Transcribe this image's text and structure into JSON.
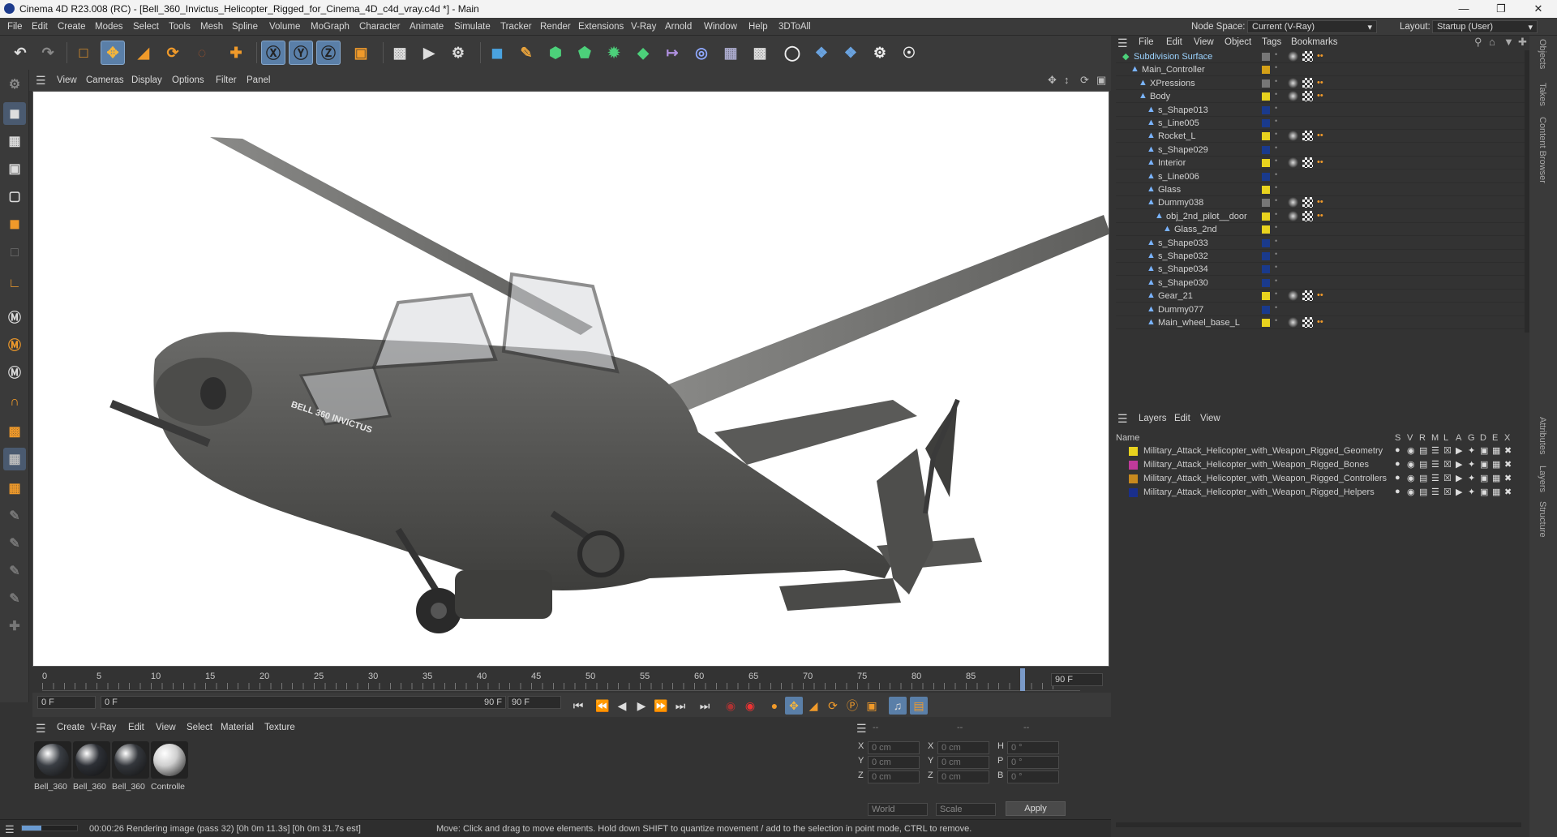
{
  "title_bar": {
    "text": "Cinema 4D R23.008 (RC) - [Bell_360_Invictus_Helicopter_Rigged_for_Cinema_4D_c4d_vray.c4d *] - Main"
  },
  "menu": [
    "File",
    "Edit",
    "Create",
    "Modes",
    "Select",
    "Tools",
    "Mesh",
    "Spline",
    "Volume",
    "MoGraph",
    "Character",
    "Animate",
    "Simulate",
    "Tracker",
    "Render",
    "Extensions",
    "V-Ray",
    "Arnold",
    "Window",
    "Help",
    "3DToAll"
  ],
  "node_space": {
    "label": "Node Space:",
    "value": "Current (V-Ray)"
  },
  "layout": {
    "label": "Layout:",
    "value": "Startup (User)"
  },
  "viewport_menu": [
    "View",
    "Cameras",
    "Display",
    "Options",
    "Filter",
    "Panel"
  ],
  "model_text": "BELL 360 INVICTUS",
  "timeline": {
    "ticks": [
      "0",
      "5",
      "10",
      "15",
      "20",
      "25",
      "30",
      "35",
      "40",
      "45",
      "50",
      "55",
      "60",
      "65",
      "70",
      "75",
      "80",
      "85",
      "90"
    ],
    "end_field": "90 F",
    "start_field": "0 F",
    "current_field": "0 F",
    "range_end": "90 F",
    "range_end2": "90 F",
    "playhead_frame": 90
  },
  "material_menu": [
    "Create",
    "V-Ray",
    "Edit",
    "View",
    "Select",
    "Material",
    "Texture"
  ],
  "materials": [
    {
      "label": "Bell_360",
      "color": "#3a3e44"
    },
    {
      "label": "Bell_360",
      "color": "#2d3036"
    },
    {
      "label": "Bell_360",
      "color": "#34373c"
    },
    {
      "label": "Controlle",
      "color": "#cfcfcf"
    }
  ],
  "coords": {
    "header": [
      "--",
      "--",
      "--"
    ],
    "rows": [
      {
        "a": "X",
        "av": "0 cm",
        "b": "X",
        "bv": "0 cm",
        "c": "H",
        "cv": "0 °"
      },
      {
        "a": "Y",
        "av": "0 cm",
        "b": "Y",
        "bv": "0 cm",
        "c": "P",
        "cv": "0 °"
      },
      {
        "a": "Z",
        "av": "0 cm",
        "b": "Z",
        "bv": "0 cm",
        "c": "B",
        "cv": "0 °"
      }
    ],
    "world": "World",
    "scale": "Scale",
    "apply": "Apply"
  },
  "status": {
    "render": "00:00:26 Rendering image (pass 32) [0h  0m 11.3s] [0h  0m 31.7s est]",
    "hint": "Move: Click and drag to move elements. Hold down SHIFT to quantize movement / add to the selection in point mode, CTRL to remove."
  },
  "object_manager": {
    "menu": [
      "File",
      "Edit",
      "View",
      "Object",
      "Tags",
      "Bookmarks"
    ],
    "rows": [
      {
        "name": "Subdivision Surface",
        "indent": 0,
        "swatch": "none",
        "color": "#9bd3ff"
      },
      {
        "name": "Main_Controller",
        "indent": 1,
        "swatch": "#d4a017",
        "color": "#d2d2d2"
      },
      {
        "name": "XPressions",
        "indent": 2,
        "swatch": "none",
        "color": "#d2d2d2"
      },
      {
        "name": "Body",
        "indent": 2,
        "swatch": "#e8d21e",
        "color": "#d2d2d2"
      },
      {
        "name": "s_Shape013",
        "indent": 3,
        "swatch": "#1a3a8c",
        "color": "#d2d2d2"
      },
      {
        "name": "s_Line005",
        "indent": 3,
        "swatch": "#1a3a8c",
        "color": "#d2d2d2"
      },
      {
        "name": "Rocket_L",
        "indent": 3,
        "swatch": "#e8d21e",
        "color": "#d2d2d2"
      },
      {
        "name": "s_Shape029",
        "indent": 3,
        "swatch": "#1a3a8c",
        "color": "#d2d2d2"
      },
      {
        "name": "Interior",
        "indent": 3,
        "swatch": "#e8d21e",
        "color": "#d2d2d2"
      },
      {
        "name": "s_Line006",
        "indent": 3,
        "swatch": "#1a3a8c",
        "color": "#d2d2d2"
      },
      {
        "name": "Glass",
        "indent": 3,
        "swatch": "#e8d21e",
        "color": "#d2d2d2"
      },
      {
        "name": "Dummy038",
        "indent": 3,
        "swatch": "none",
        "color": "#d2d2d2"
      },
      {
        "name": "obj_2nd_pilot__door",
        "indent": 4,
        "swatch": "#e8d21e",
        "color": "#d2d2d2"
      },
      {
        "name": "Glass_2nd",
        "indent": 5,
        "swatch": "#e8d21e",
        "color": "#d2d2d2"
      },
      {
        "name": "s_Shape033",
        "indent": 3,
        "swatch": "#1a3a8c",
        "color": "#d2d2d2"
      },
      {
        "name": "s_Shape032",
        "indent": 3,
        "swatch": "#1a3a8c",
        "color": "#d2d2d2"
      },
      {
        "name": "s_Shape034",
        "indent": 3,
        "swatch": "#1a3a8c",
        "color": "#d2d2d2"
      },
      {
        "name": "s_Shape030",
        "indent": 3,
        "swatch": "#1a3a8c",
        "color": "#d2d2d2"
      },
      {
        "name": "Gear_21",
        "indent": 3,
        "swatch": "#e8d21e",
        "color": "#d2d2d2"
      },
      {
        "name": "Dummy077",
        "indent": 3,
        "swatch": "#1a3a8c",
        "color": "#d2d2d2"
      },
      {
        "name": "Main_wheel_base_L",
        "indent": 3,
        "swatch": "#e8d21e",
        "color": "#d2d2d2"
      }
    ]
  },
  "layer_manager": {
    "menu": [
      "Layers",
      "Edit",
      "View"
    ],
    "name_header": "Name",
    "columns": [
      "S",
      "V",
      "R",
      "M",
      "L",
      "A",
      "G",
      "D",
      "E",
      "X"
    ],
    "layers": [
      {
        "name": "Military_Attack_Helicopter_with_Weapon_Rigged_Geometry",
        "color": "#e8d21e"
      },
      {
        "name": "Military_Attack_Helicopter_with_Weapon_Rigged_Bones",
        "color": "#c03a9a"
      },
      {
        "name": "Military_Attack_Helicopter_with_Weapon_Rigged_Controllers",
        "color": "#c8891e"
      },
      {
        "name": "Military_Attack_Helicopter_with_Weapon_Rigged_Helpers",
        "color": "#1a2f8c"
      }
    ]
  },
  "side_tabs": [
    "Objects",
    "Takes",
    "Content Browser",
    "Attributes",
    "Layers",
    "Structure"
  ]
}
